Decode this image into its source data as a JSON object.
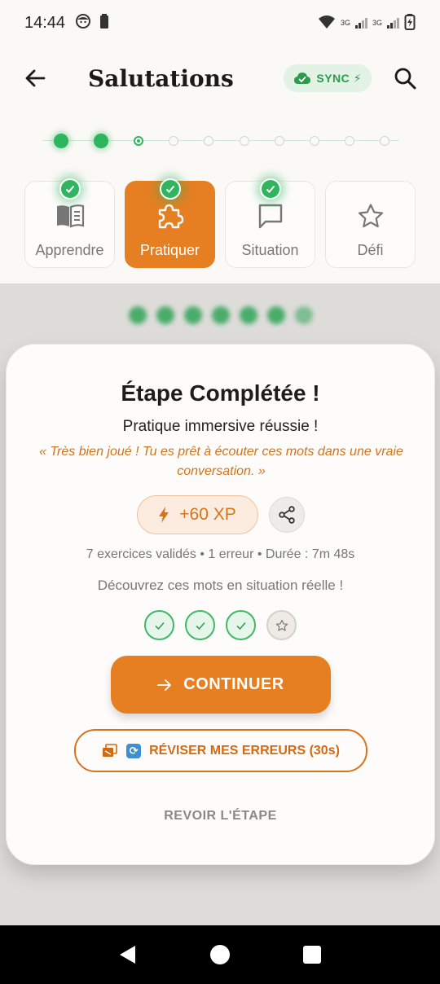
{
  "status_bar": {
    "time": "14:44",
    "network_label_1": "3G",
    "network_label_2": "3G"
  },
  "header": {
    "title": "Salutations",
    "sync_label": "SYNC ⚡"
  },
  "progress": {
    "total_steps": 10,
    "completed_steps": 2,
    "current_step": 3
  },
  "tabs": [
    {
      "label": "Apprendre",
      "completed": true,
      "active": false,
      "icon": "book-icon"
    },
    {
      "label": "Pratiquer",
      "completed": true,
      "active": true,
      "icon": "puzzle-icon"
    },
    {
      "label": "Situation",
      "completed": true,
      "active": false,
      "icon": "chat-icon"
    },
    {
      "label": "Défi",
      "completed": false,
      "active": false,
      "icon": "star-icon"
    }
  ],
  "modal": {
    "title": "Étape Complétée !",
    "subtitle": "Pratique immersive réussie !",
    "quote": "« Très bien joué ! Tu es prêt à écouter ces mots dans une vraie conversation. »",
    "xp": "+60 XP",
    "stats": "7 exercices validés • 1 erreur • Durée : 7m 48s",
    "discover": "Découvrez ces mots en situation réelle !",
    "continue_label": "CONTINUER",
    "review_label": "RÉVISER MES ERREURS (30s)",
    "revoir_label": "REVOIR L'ÉTAPE"
  },
  "colors": {
    "accent": "#e67e22",
    "success": "#2fb55e",
    "quote": "#d0741c"
  }
}
